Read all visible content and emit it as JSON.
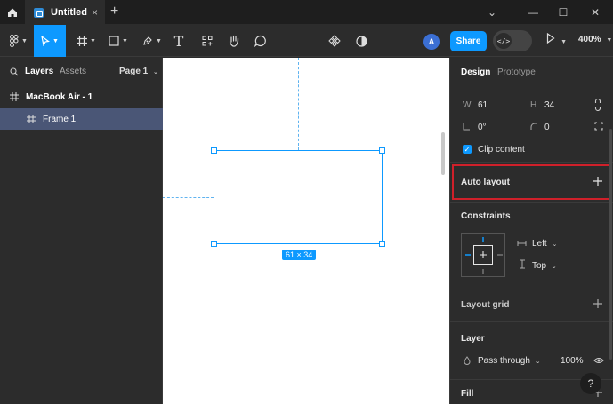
{
  "tab": {
    "title": "Untitled",
    "close": "×",
    "new": "+"
  },
  "window": {
    "dropdown": "⌄",
    "minimize": "—",
    "maximize": "☐",
    "close": "✕"
  },
  "toolbar": {
    "share_label": "Share",
    "avatar_initial": "A",
    "zoom_label": "400%",
    "dev_mode_glyph": "</>",
    "text_tool_glyph": "T"
  },
  "left_panel": {
    "tabs": {
      "layers": "Layers",
      "assets": "Assets",
      "page": "Page 1"
    },
    "layers": [
      {
        "name": "MacBook Air - 1",
        "selected": false
      },
      {
        "name": "Frame 1",
        "selected": true
      }
    ]
  },
  "canvas": {
    "frame_dimensions": "61 × 34",
    "accent": "#0d99ff"
  },
  "right_panel": {
    "tabs": {
      "design": "Design",
      "prototype": "Prototype"
    },
    "size": {
      "w_label": "W",
      "w_value": "61",
      "h_label": "H",
      "h_value": "34"
    },
    "rotation": {
      "value": "0°"
    },
    "radius": {
      "value": "0"
    },
    "clip_content": "Clip content",
    "auto_layout": "Auto layout",
    "constraints": {
      "title": "Constraints",
      "horizontal": "Left",
      "vertical": "Top"
    },
    "layout_grid": "Layout grid",
    "layer": {
      "title": "Layer",
      "blend": "Pass through",
      "opacity": "100%"
    },
    "fill": "Fill",
    "help": "?"
  },
  "colors": {
    "accent": "#0d99ff",
    "highlight": "#d0202a",
    "panel": "#2c2c2c",
    "selected_row": "#4a5676"
  }
}
